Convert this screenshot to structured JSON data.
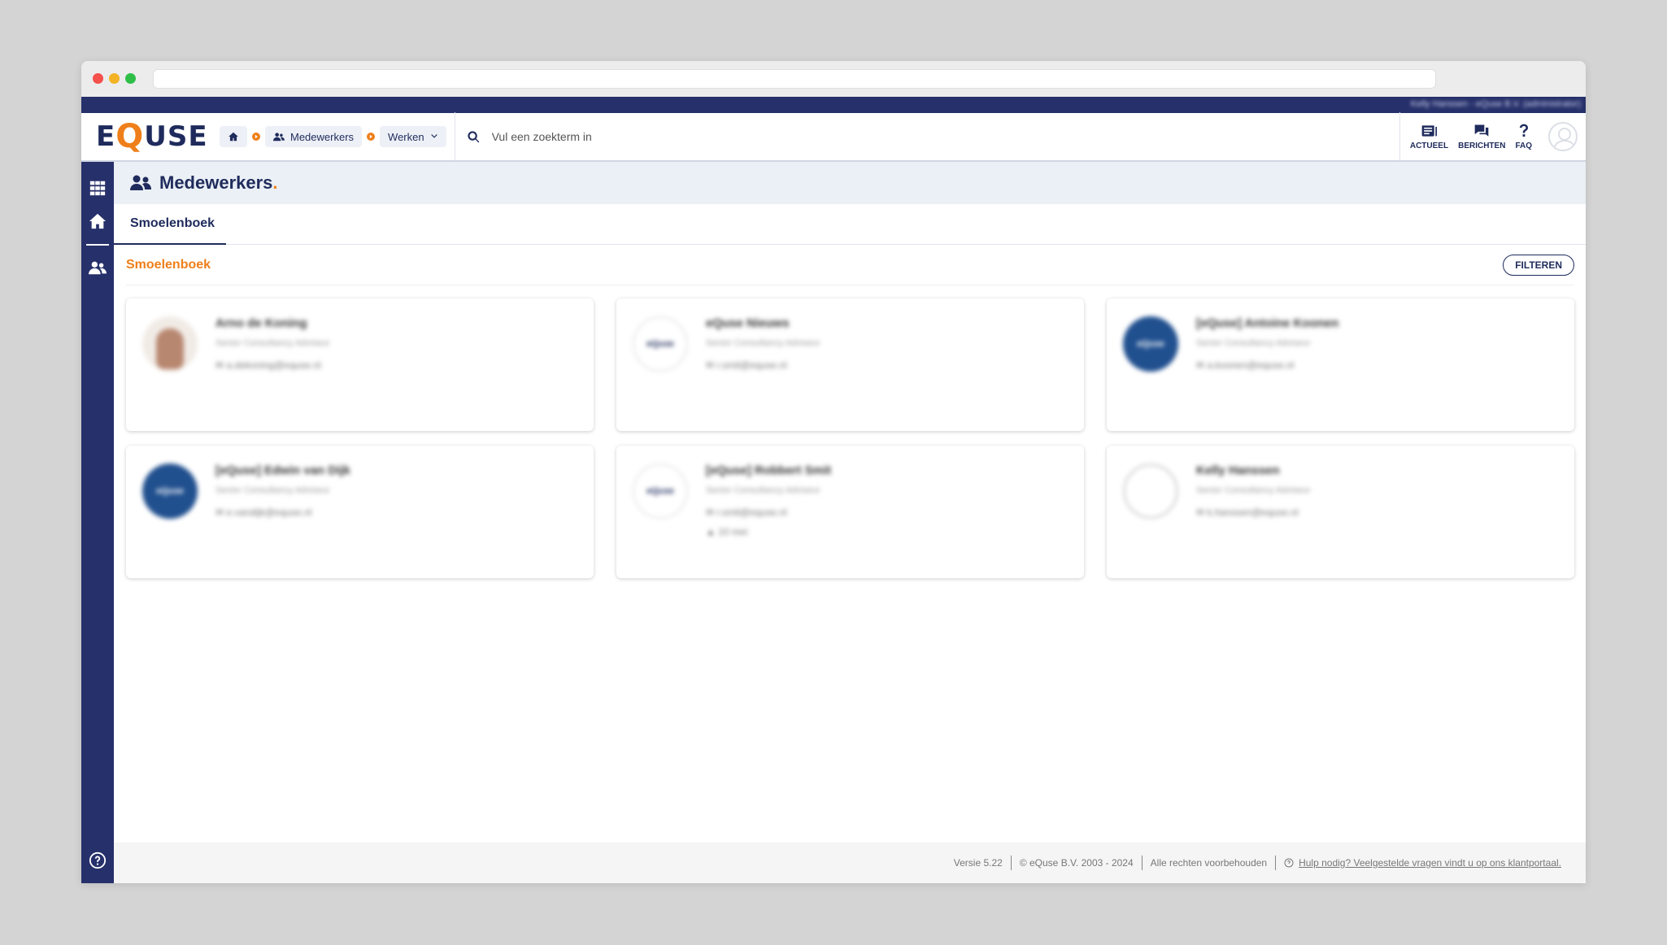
{
  "header": {
    "user_info": "Kelly Hanssen - eQuse B.V. (administrator)",
    "logo_parts": [
      "E",
      "Q",
      "USE"
    ],
    "breadcrumb": {
      "home_label": "",
      "section_label": "Medewerkers",
      "dropdown_label": "Werken"
    },
    "search_placeholder": "Vul een zoekterm in",
    "actions": [
      {
        "label": "ACTUEEL",
        "icon": "news-icon"
      },
      {
        "label": "BERICHTEN",
        "icon": "messages-icon"
      },
      {
        "label": "FAQ",
        "icon": "question-icon"
      }
    ]
  },
  "page": {
    "title": "Medewerkers",
    "title_dot": ".",
    "tabs": [
      {
        "label": "Smoelenboek",
        "active": true
      }
    ],
    "section_title": "Smoelenboek",
    "filter_button": "FILTEREN"
  },
  "employees": [
    {
      "name": "Arno de Koning",
      "role": "Senior Consultancy Adviseur",
      "email": "a.dekoning@equse.nl",
      "avatar": "photo"
    },
    {
      "name": "eQuse Nieuws",
      "role": "Senior Consultancy Adviseur",
      "email": "r.smit@equse.nl",
      "avatar": "logo-white"
    },
    {
      "name": "[eQuse] Antoine Koonen",
      "role": "Senior Consultancy Adviseur",
      "email": "a.koonen@equse.nl",
      "avatar": "logo-blue"
    },
    {
      "name": "[eQuse] Edwin van Dijk",
      "role": "Senior Consultancy Adviseur",
      "email": "e.vandijk@equse.nl",
      "avatar": "logo-blue"
    },
    {
      "name": "[eQuse] Robbert Smit",
      "role": "Senior Consultancy Adviseur",
      "email": "r.smit@equse.nl",
      "extra": "10 mei",
      "avatar": "logo-white"
    },
    {
      "name": "Kelly Hanssen",
      "role": "Senior Consultancy Adviseur",
      "email": "k.hanssen@equse.nl",
      "avatar": "empty"
    }
  ],
  "logo_text": "eQuse",
  "footer": {
    "version": "Versie 5.22",
    "copyright": "© eQuse B.V. 2003 - 2024",
    "rights": "Alle rechten voorbehouden",
    "help_link": "Hulp nodig? Veelgestelde vragen vindt u op ons klantportaal."
  }
}
